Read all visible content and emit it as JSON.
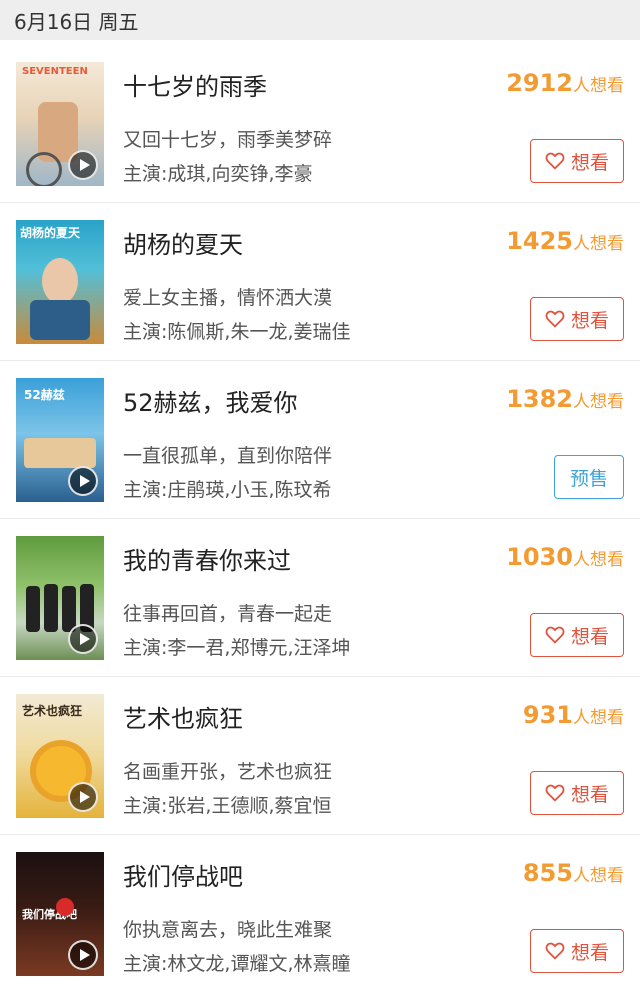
{
  "header": {
    "date_label": "6月16日 周五"
  },
  "colors": {
    "want_count": "#f39b33",
    "want_button": "#e0533c",
    "presale_button": "#3fa2d9"
  },
  "movies": [
    {
      "title": "十七岁的雨季",
      "want_count": "2912",
      "want_unit": "人想看",
      "tagline": "又回十七岁，雨季美梦碎",
      "cast": "主演:成琪,向奕铮,李豪",
      "action_label": "想看",
      "action_type": "want",
      "has_trailer": true,
      "poster_text": "SEVENTEEN"
    },
    {
      "title": "胡杨的夏天",
      "want_count": "1425",
      "want_unit": "人想看",
      "tagline": "爱上女主播，情怀洒大漠",
      "cast": "主演:陈佩斯,朱一龙,姜瑞佳",
      "action_label": "想看",
      "action_type": "want",
      "has_trailer": false,
      "poster_text": "胡杨的夏天"
    },
    {
      "title": "52赫兹，我爱你",
      "want_count": "1382",
      "want_unit": "人想看",
      "tagline": "一直很孤单，直到你陪伴",
      "cast": "主演:庄鹃瑛,小玉,陈玟希",
      "action_label": "预售",
      "action_type": "presale",
      "has_trailer": true,
      "poster_text": "52赫兹"
    },
    {
      "title": "我的青春你来过",
      "want_count": "1030",
      "want_unit": "人想看",
      "tagline": "往事再回首，青春一起走",
      "cast": "主演:李一君,郑博元,汪泽坤",
      "action_label": "想看",
      "action_type": "want",
      "has_trailer": true,
      "poster_text": ""
    },
    {
      "title": "艺术也疯狂",
      "want_count": "931",
      "want_unit": "人想看",
      "tagline": "名画重开张，艺术也疯狂",
      "cast": "主演:张岩,王德顺,蔡宜恒",
      "action_label": "想看",
      "action_type": "want",
      "has_trailer": true,
      "poster_text": "艺术也疯狂"
    },
    {
      "title": "我们停战吧",
      "want_count": "855",
      "want_unit": "人想看",
      "tagline": "你执意离去，晓此生难聚",
      "cast": "主演:林文龙,谭耀文,林熹瞳",
      "action_label": "想看",
      "action_type": "want",
      "has_trailer": true,
      "poster_text": "我们停战吧"
    }
  ]
}
